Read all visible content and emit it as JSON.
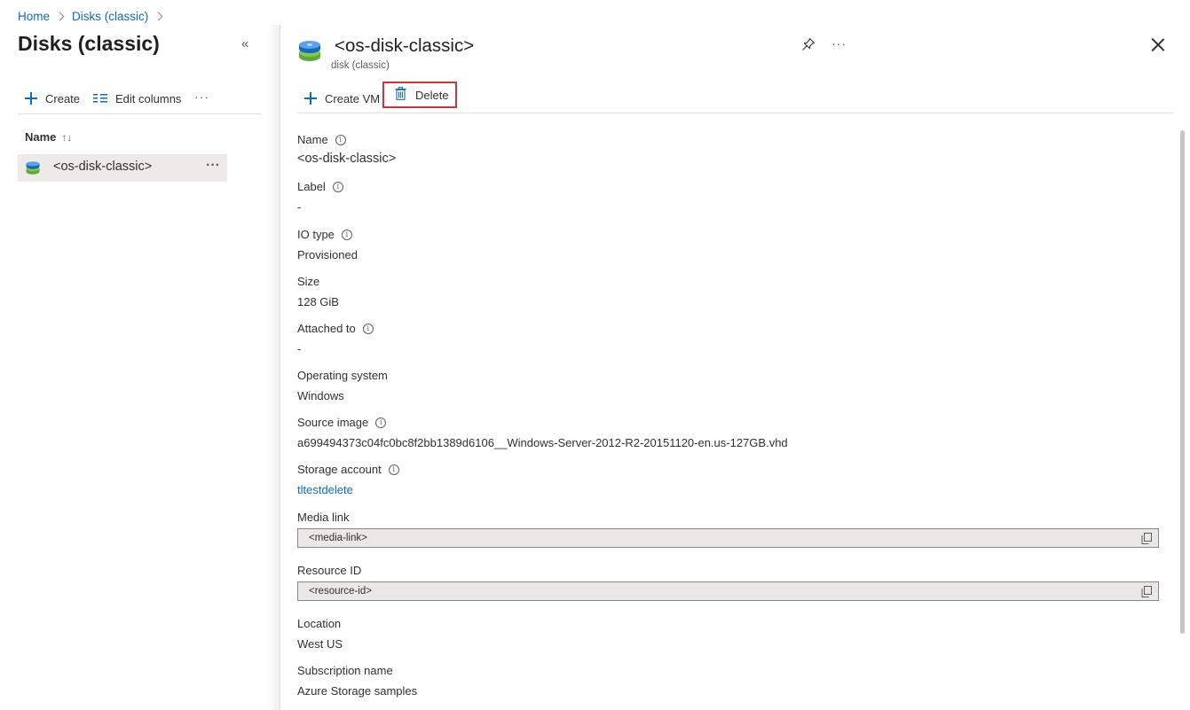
{
  "breadcrumb": {
    "home": "Home",
    "current": "Disks (classic)"
  },
  "left_pane": {
    "title": "Disks (classic)",
    "toolbar": {
      "create": "Create",
      "edit_columns": "Edit columns",
      "more": "···"
    },
    "column_header": "Name",
    "sort_icon": "↑↓",
    "rows": [
      {
        "label": "<os-disk-classic>",
        "more": "···"
      }
    ]
  },
  "detail": {
    "title": "<os-disk-classic>",
    "subtitle": "disk (classic)",
    "header_more": "···",
    "toolbar": {
      "create_vm": "Create VM",
      "delete": "Delete"
    },
    "properties": {
      "name": {
        "label": "Name",
        "value": "<os-disk-classic>"
      },
      "label": {
        "label": "Label",
        "value": "-"
      },
      "io_type": {
        "label": "IO type",
        "value": "Provisioned"
      },
      "size": {
        "label": "Size",
        "value": "128 GiB"
      },
      "attached_to": {
        "label": "Attached to",
        "value": "-"
      },
      "os": {
        "label": "Operating system",
        "value": "Windows"
      },
      "source_image": {
        "label": "Source image",
        "value": "a699494373c04fc0bc8f2bb1389d6106__Windows-Server-2012-R2-20151120-en.us-127GB.vhd"
      },
      "storage_account": {
        "label": "Storage account",
        "value": "tltestdelete"
      },
      "media_link": {
        "label": "Media link",
        "value": "<media-link>"
      },
      "resource_id": {
        "label": "Resource ID",
        "value": "<resource-id>"
      },
      "location": {
        "label": "Location",
        "value": "West US"
      },
      "subscription": {
        "label": "Subscription name",
        "value": "Azure Storage samples"
      }
    }
  },
  "colors": {
    "accent": "#0f6cbd",
    "highlight_border": "#d13438",
    "selected_row": "#edebe9"
  },
  "icons": [
    "plus-icon",
    "edit-columns-icon",
    "sort-icon",
    "disk-icon",
    "pin-icon",
    "close-icon",
    "trash-icon",
    "info-icon",
    "copy-icon",
    "collapse-icon"
  ]
}
